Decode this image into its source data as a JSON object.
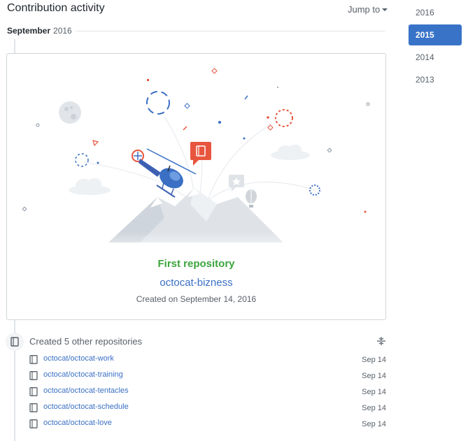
{
  "header": {
    "title": "Contribution activity",
    "jump_label": "Jump to"
  },
  "month": {
    "name": "September",
    "year": "2016"
  },
  "years": [
    "2016",
    "2015",
    "2014",
    "2013"
  ],
  "active_year": "2015",
  "first_repo": {
    "label": "First repository",
    "name": "octocat-bizness",
    "created": "Created on September 14, 2016"
  },
  "other_repos": {
    "title": "Created 5 other repositories",
    "items": [
      {
        "name": "octocat/octocat-work",
        "date": "Sep 14"
      },
      {
        "name": "octocat/octocat-training",
        "date": "Sep 14"
      },
      {
        "name": "octocat/octocat-tentacles",
        "date": "Sep 14"
      },
      {
        "name": "octocat/octocat-schedule",
        "date": "Sep 14"
      },
      {
        "name": "octocat/octocat-love",
        "date": "Sep 14"
      }
    ]
  },
  "colors": {
    "link": "#3a6fc4",
    "success": "#3ca53d",
    "active_year_bg": "#3873c8",
    "muted": "#586069"
  },
  "icons": {
    "repo": "repo-icon",
    "collapse": "collapse-icon",
    "caret": "caret-down-icon"
  }
}
